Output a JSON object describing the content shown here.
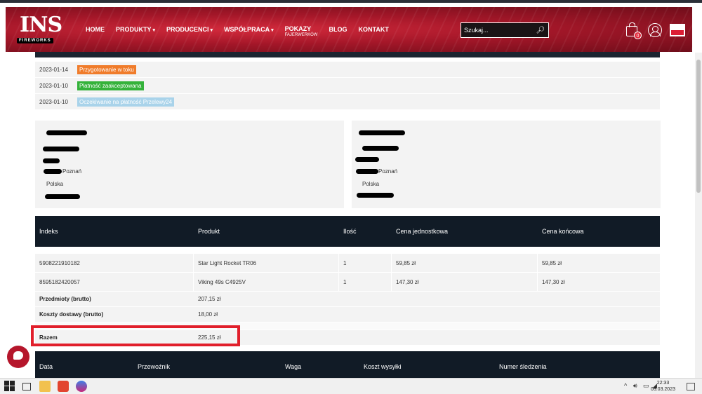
{
  "header": {
    "logo_text": "INS",
    "logo_sub": "FIREWORKS",
    "nav": [
      {
        "label": "HOME",
        "caret": ""
      },
      {
        "label": "PRODUKTY",
        "caret": "▾"
      },
      {
        "label": "PRODUCENCI",
        "caret": "▾"
      },
      {
        "label": "WSPÓŁPRACA",
        "caret": "▾"
      },
      {
        "label": "POKAZY",
        "sub": "FAJERWERKÓW",
        "caret": ""
      },
      {
        "label": "BLOG",
        "caret": ""
      },
      {
        "label": "KONTAKT",
        "caret": ""
      }
    ],
    "search_placeholder": "Szukaj...",
    "cart_count": "0"
  },
  "status_history": [
    {
      "date": "2023-01-14",
      "status": "Przygotowanie w toku",
      "color": "#f07c2b"
    },
    {
      "date": "2023-01-10",
      "status": "Płatność zaakceptowana",
      "color": "#34b23a"
    },
    {
      "date": "2023-01-10",
      "status": "Oczekiwanie na płatność Przelewy24",
      "color": "#a9d3ea"
    }
  ],
  "address_left": {
    "city": "Poznań",
    "country": "Polska"
  },
  "address_right": {
    "city": "Poznań",
    "country": "Polska"
  },
  "products": {
    "headers": [
      "Indeks",
      "Produkt",
      "Ilość",
      "Cena jednostkowa",
      "Cena końcowa"
    ],
    "rows": [
      [
        "5908221910182",
        "Star Light Rocket TR06",
        "1",
        "59,85 zł",
        "59,85 zł"
      ],
      [
        "8595182420057",
        "Viking 49s C4925V",
        "1",
        "147,30 zł",
        "147,30 zł"
      ]
    ],
    "summary": [
      {
        "label": "Przedmioty (brutto)",
        "value": "207,15 zł"
      },
      {
        "label": "Koszty dostawy (brutto)",
        "value": "18,00 zł"
      }
    ],
    "total": {
      "label": "Razem",
      "value": "225,15 zł"
    }
  },
  "shipping": {
    "headers": [
      "Data",
      "Przewoźnik",
      "Waga",
      "Koszt wysyłki",
      "Numer śledzenia"
    ]
  },
  "taskbar": {
    "time": "22:33",
    "date": "03.03.2023"
  }
}
